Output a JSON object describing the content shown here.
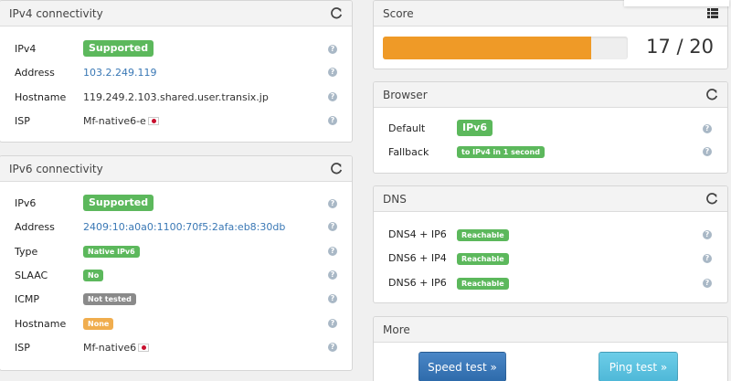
{
  "ipv4": {
    "title": "IPv4 connectivity",
    "rows": {
      "ipv4": {
        "label": "IPv4",
        "badge": "Supported"
      },
      "address": {
        "label": "Address",
        "value": "103.2.249.119"
      },
      "hostname": {
        "label": "Hostname",
        "value": "119.249.2.103.shared.user.transix.jp"
      },
      "isp": {
        "label": "ISP",
        "value": "Mf-native6-e"
      }
    }
  },
  "ipv6": {
    "title": "IPv6 connectivity",
    "rows": {
      "ipv6": {
        "label": "IPv6",
        "badge": "Supported"
      },
      "address": {
        "label": "Address",
        "value": "2409:10:a0a0:1100:70f5:2afa:eb8:30db"
      },
      "type": {
        "label": "Type",
        "badge": "Native IPv6"
      },
      "slaac": {
        "label": "SLAAC",
        "badge": "No"
      },
      "icmp": {
        "label": "ICMP",
        "badge": "Not tested"
      },
      "hostname": {
        "label": "Hostname",
        "badge": "None"
      },
      "isp": {
        "label": "ISP",
        "value": "Mf-native6"
      }
    }
  },
  "score": {
    "title": "Score",
    "value": "17 / 20",
    "fraction": 0.85
  },
  "browser": {
    "title": "Browser",
    "default": {
      "label": "Default",
      "badge": "IPv6"
    },
    "fallback": {
      "label": "Fallback",
      "badge": "to IPv4 in 1 second"
    }
  },
  "dns": {
    "title": "DNS",
    "rows": [
      {
        "label": "DNS4 + IP6",
        "badge": "Reachable"
      },
      {
        "label": "DNS6 + IP4",
        "badge": "Reachable"
      },
      {
        "label": "DNS6 + IP6",
        "badge": "Reachable"
      }
    ]
  },
  "more": {
    "title": "More",
    "speed_test": "Speed test »",
    "ping_test": "Ping test »"
  },
  "colors": {
    "green": "#5cb85c",
    "grey": "#8a8a8a",
    "orange": "#f0ad4e",
    "progress": "#ef9a27",
    "link": "#3a78b5"
  },
  "icons": {
    "refresh": "refresh-icon",
    "help": "question-circle-icon",
    "list": "list-icon",
    "flag": "japan-flag-icon"
  }
}
